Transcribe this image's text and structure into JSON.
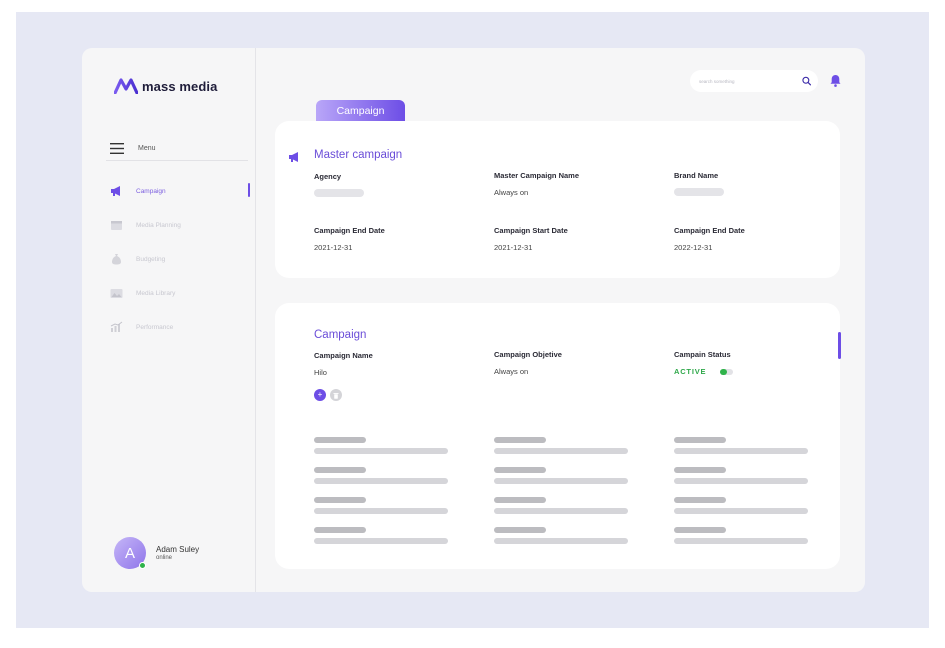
{
  "app": {
    "name": "mass media"
  },
  "sidebar": {
    "menu_label": "Menu",
    "items": [
      {
        "label": "Campaign",
        "icon": "megaphone-icon",
        "active": true
      },
      {
        "label": "Media Planning",
        "icon": "calendar-icon",
        "active": false
      },
      {
        "label": "Budgeting",
        "icon": "money-bag-icon",
        "active": false
      },
      {
        "label": "Media Library",
        "icon": "image-icon",
        "active": false
      },
      {
        "label": "Performance",
        "icon": "bar-chart-icon",
        "active": false
      }
    ]
  },
  "user": {
    "initial": "A",
    "name": "Adam Suley",
    "status": "online"
  },
  "header": {
    "search_placeholder": "search something",
    "search_icon": "search-icon",
    "notification_icon": "bell-icon"
  },
  "tab": {
    "label": "Campaign"
  },
  "master_campaign": {
    "title": "Master campaign",
    "fields": [
      {
        "label": "Agency",
        "value": ""
      },
      {
        "label": "Master Campaign Name",
        "value": "Always on"
      },
      {
        "label": "Brand Name",
        "value": ""
      },
      {
        "label": "Campaign End Date",
        "value": "2021-12-31"
      },
      {
        "label": "Campaign Start Date",
        "value": "2021-12-31"
      },
      {
        "label": "Campaign End Date",
        "value": "2022-12-31"
      }
    ]
  },
  "campaign": {
    "title": "Campaign",
    "fields": [
      {
        "label": "Campaign Name",
        "value": "Hilo"
      },
      {
        "label": "Campaign Objetive",
        "value": "Always on"
      },
      {
        "label": "Campain Status",
        "value": "ACTIVE"
      }
    ],
    "add_button": "+",
    "status_toggle_on": true
  },
  "colors": {
    "accent": "#6d4ee6",
    "accent_light": "#b9a6f8",
    "active_green": "#2fa84a",
    "background": "#e6e8f4"
  }
}
